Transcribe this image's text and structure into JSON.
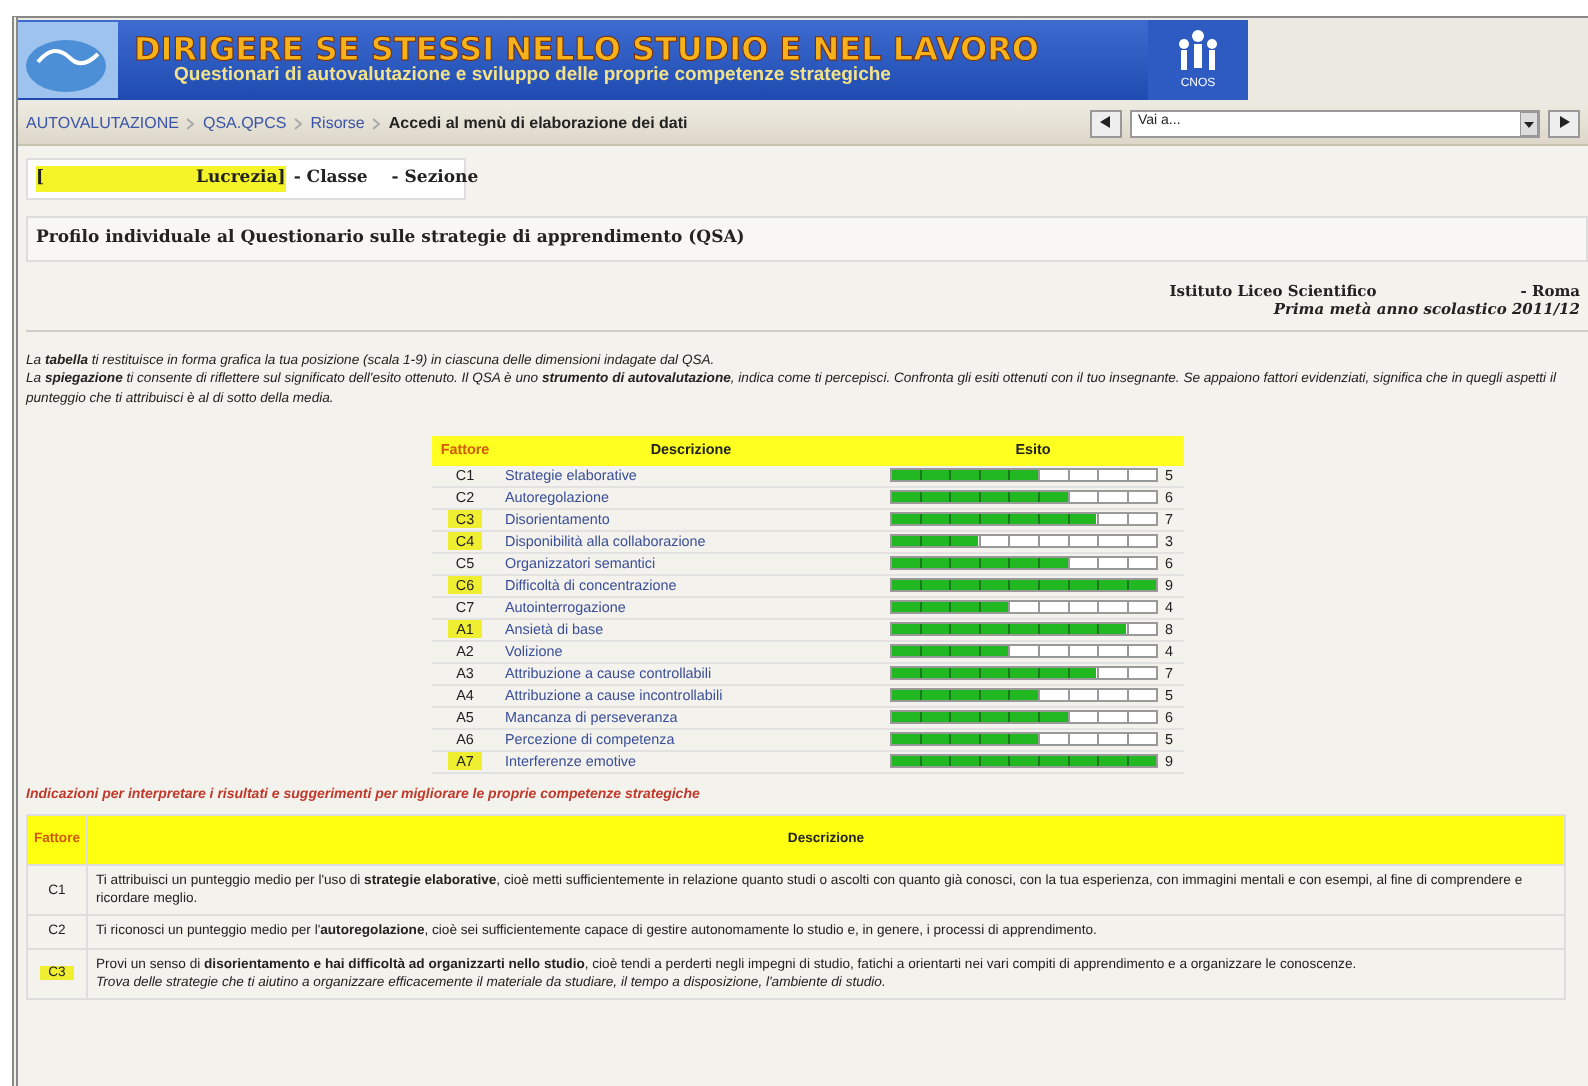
{
  "banner": {
    "title": "DIRIGERE SE STESSI NELLO STUDIO E NEL LAVORO",
    "subtitle": "Questionari di autovalutazione e sviluppo delle proprie competenze strategiche",
    "logo_caption": "CNOS"
  },
  "breadcrumb": [
    {
      "label": "AUTOVALUTAZIONE",
      "kind": "link"
    },
    {
      "label": "QSA.QPCS",
      "kind": "link"
    },
    {
      "label": "Risorse",
      "kind": "link"
    },
    {
      "label": "Accedi al menù di elaborazione dei dati",
      "kind": "current"
    }
  ],
  "goto": {
    "value": "Vai a..."
  },
  "student": {
    "open": "[",
    "name": "Lucrezia]",
    "class_label": "- Classe",
    "section_label": "- Sezione"
  },
  "heading": "Profilo individuale al Questionario sulle strategie di apprendimento (QSA)",
  "school": {
    "name": "Istituto Liceo Scientifico",
    "city": "- Roma",
    "period": "Prima metà anno scolastico 2011/12"
  },
  "intro": [
    "La **tabella** ti restituisce in forma grafica la tua posizione (scala 1-9) in ciascuna delle dimensioni indagate dal QSA.",
    "La **spiegazione** ti consente di riflettere sul significato dell'esito ottenuto. Il QSA è uno **strumento di autovalutazione**, indica come ti percepisci. Confronta gli esiti ottenuti con il tuo insegnante. Se appaiono fattori evidenziati, significa che in quegli aspetti il punteggio che ti attribuisci è al di sotto della media."
  ],
  "results": {
    "columns": [
      "Fattore",
      "Descrizione",
      "Esito"
    ],
    "rows": [
      {
        "code": "C1",
        "label": "Strategie elaborative",
        "level": 0.556,
        "reading": "5",
        "highlighted": false
      },
      {
        "code": "C2",
        "label": "Autoregolazione",
        "level": 0.667,
        "reading": "6",
        "highlighted": false
      },
      {
        "code": "C3",
        "label": "Disorientamento",
        "level": 0.778,
        "reading": "7",
        "highlighted": true
      },
      {
        "code": "C4",
        "label": "Disponibilità alla collaborazione",
        "level": 0.333,
        "reading": "3",
        "highlighted": true
      },
      {
        "code": "C5",
        "label": "Organizzatori semantici",
        "level": 0.667,
        "reading": "6",
        "highlighted": false
      },
      {
        "code": "C6",
        "label": "Difficoltà di concentrazione",
        "level": 1,
        "reading": "9",
        "highlighted": true
      },
      {
        "code": "C7",
        "label": "Autointerrogazione",
        "level": 0.444,
        "reading": "4",
        "highlighted": false
      },
      {
        "code": "A1",
        "label": "Ansietà di base",
        "level": 0.889,
        "reading": "8",
        "highlighted": true
      },
      {
        "code": "A2",
        "label": "Volizione",
        "level": 0.444,
        "reading": "4",
        "highlighted": false
      },
      {
        "code": "A3",
        "label": "Attribuzione a cause controllabili",
        "level": 0.778,
        "reading": "7",
        "highlighted": false
      },
      {
        "code": "A4",
        "label": "Attribuzione a cause incontrollabili",
        "level": 0.556,
        "reading": "5",
        "highlighted": false
      },
      {
        "code": "A5",
        "label": "Mancanza di perseveranza",
        "level": 0.667,
        "reading": "6",
        "highlighted": false
      },
      {
        "code": "A6",
        "label": "Percezione di competenza",
        "level": 0.556,
        "reading": "5",
        "highlighted": false
      },
      {
        "code": "A7",
        "label": "Interferenze emotive",
        "level": 1,
        "reading": "9",
        "highlighted": true
      }
    ]
  },
  "advice_title": "Indicazioni per interpretare i risultati e suggerimenti per migliorare le proprie competenze strategiche",
  "advice": {
    "columns": [
      "Fattore",
      "Descrizione"
    ],
    "rows": [
      {
        "code": "C1",
        "highlighted": false,
        "text": [
          "Ti attribuisci un punteggio medio per l'uso di **strategie elaborative**, cioè metti sufficientemente in relazione quanto studi o ascolti con quanto già conosci, con la tua esperienza, con immagini mentali e con esempi, al fine di comprendere e ricordare meglio."
        ]
      },
      {
        "code": "C2",
        "highlighted": false,
        "text": [
          "Ti riconosci un punteggio medio per l'**autoregolazione**, cioè sei sufficientemente capace di gestire autonomamente lo studio e, in genere, i processi di apprendimento."
        ]
      },
      {
        "code": "C3",
        "highlighted": true,
        "text": [
          "Provi un senso di **disorientamento e hai difficoltà ad organizzarti nello studio**, cioè tendi a perderti negli impegni di studio, fatichi a orientarti nei vari compiti di apprendimento e a organizzare le conoscenze.",
          "*Trova delle strategie che ti aiutino a organizzare efficacemente il materiale da studiare, il tempo a disposizione, l'ambiente di studio.*"
        ]
      }
    ]
  }
}
